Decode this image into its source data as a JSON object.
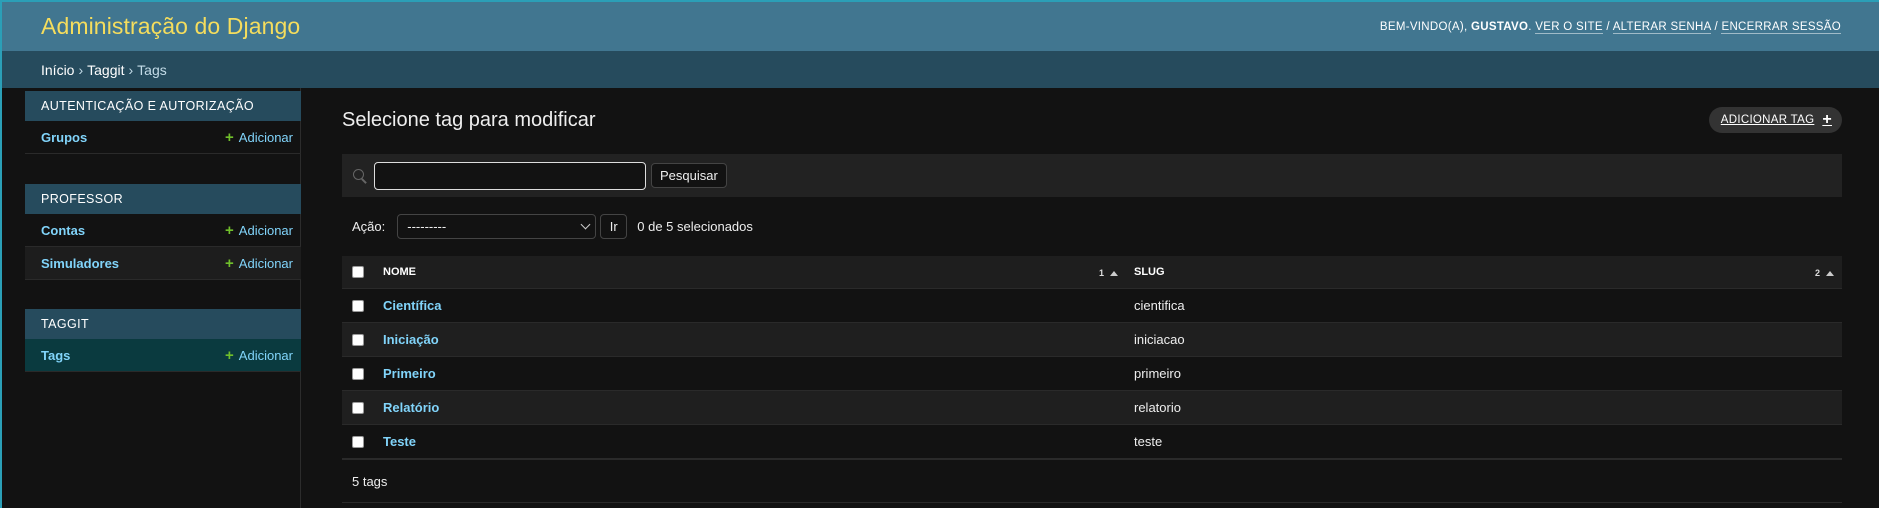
{
  "header": {
    "site_title": "Administração do Django",
    "welcome": "Bem-vindo(a),",
    "username": "Gustavo",
    "view_site": "Ver o site",
    "change_password": "Alterar senha",
    "logout": "Encerrar sessão",
    "separator": "/"
  },
  "breadcrumbs": {
    "home": "Início",
    "app": "Taggit",
    "current": "Tags",
    "sep": "›"
  },
  "sidebar": {
    "modules": [
      {
        "caption": "Autenticação e Autorização",
        "models": [
          {
            "name": "Grupos",
            "add": "Adicionar"
          }
        ]
      },
      {
        "caption": "Professor",
        "models": [
          {
            "name": "Contas",
            "add": "Adicionar"
          },
          {
            "name": "Simuladores",
            "add": "Adicionar"
          }
        ]
      },
      {
        "caption": "Taggit",
        "models": [
          {
            "name": "Tags",
            "add": "Adicionar"
          }
        ]
      }
    ],
    "plus_symbol": "+"
  },
  "content": {
    "title": "Selecione tag para modificar",
    "add_button": "Adicionar tag",
    "add_button_icon": "+",
    "search": {
      "value": "",
      "button": "Pesquisar"
    },
    "actions": {
      "label": "Ação:",
      "selected_option": "---------",
      "go_button": "Ir",
      "counter": "0 de 5 selecionados"
    },
    "table": {
      "columns": [
        {
          "label": "Nome",
          "sort_priority": "1"
        },
        {
          "label": "Slug",
          "sort_priority": "2"
        }
      ],
      "rows": [
        {
          "nome": "Científica",
          "slug": "cientifica"
        },
        {
          "nome": "Iniciação",
          "slug": "iniciacao"
        },
        {
          "nome": "Primeiro",
          "slug": "primeiro"
        },
        {
          "nome": "Relatório",
          "slug": "relatorio"
        },
        {
          "nome": "Teste",
          "slug": "teste"
        }
      ]
    },
    "paginator": "5 tags"
  },
  "colors": {
    "header_bg": "#417690",
    "breadcrumb_bg": "#264b5d",
    "site_title": "#f5dd5d",
    "link": "#81d4fa",
    "add_icon": "#70bf2b",
    "background": "#121212"
  }
}
